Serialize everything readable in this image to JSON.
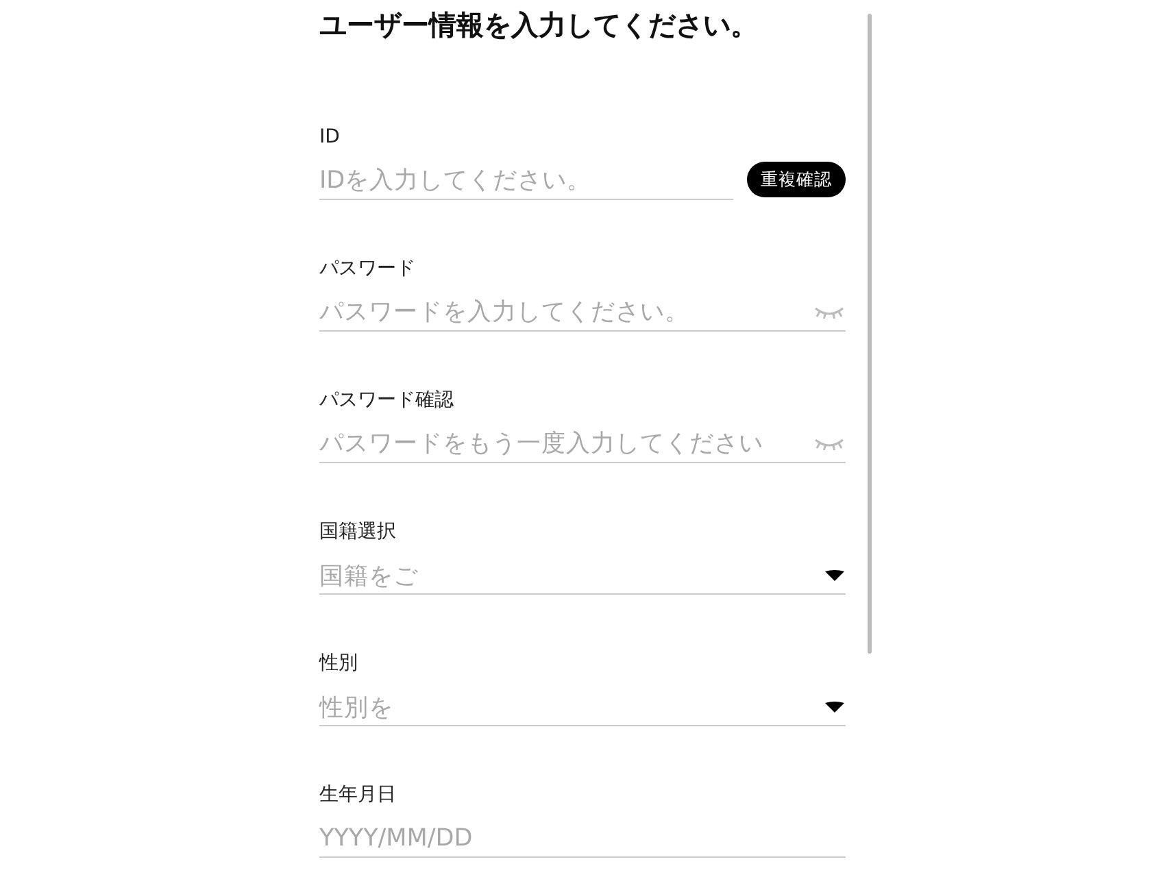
{
  "title": "ユーザー情報を入力してください。",
  "fields": [
    {
      "kind": "text",
      "label": "ID",
      "placeholder": "IDを入力してください。",
      "button": "重複確認"
    },
    {
      "kind": "password",
      "label": "パスワード",
      "placeholder": "パスワードを入力してください。"
    },
    {
      "kind": "password",
      "label": "パスワード確認",
      "placeholder": "パスワードをもう一度入力してください"
    },
    {
      "kind": "select",
      "label": "国籍選択",
      "placeholder": "国籍をご"
    },
    {
      "kind": "select",
      "label": "性別",
      "placeholder": "性別を"
    },
    {
      "kind": "date",
      "label": "生年月日",
      "placeholder": "YYYY/MM/DD"
    }
  ]
}
